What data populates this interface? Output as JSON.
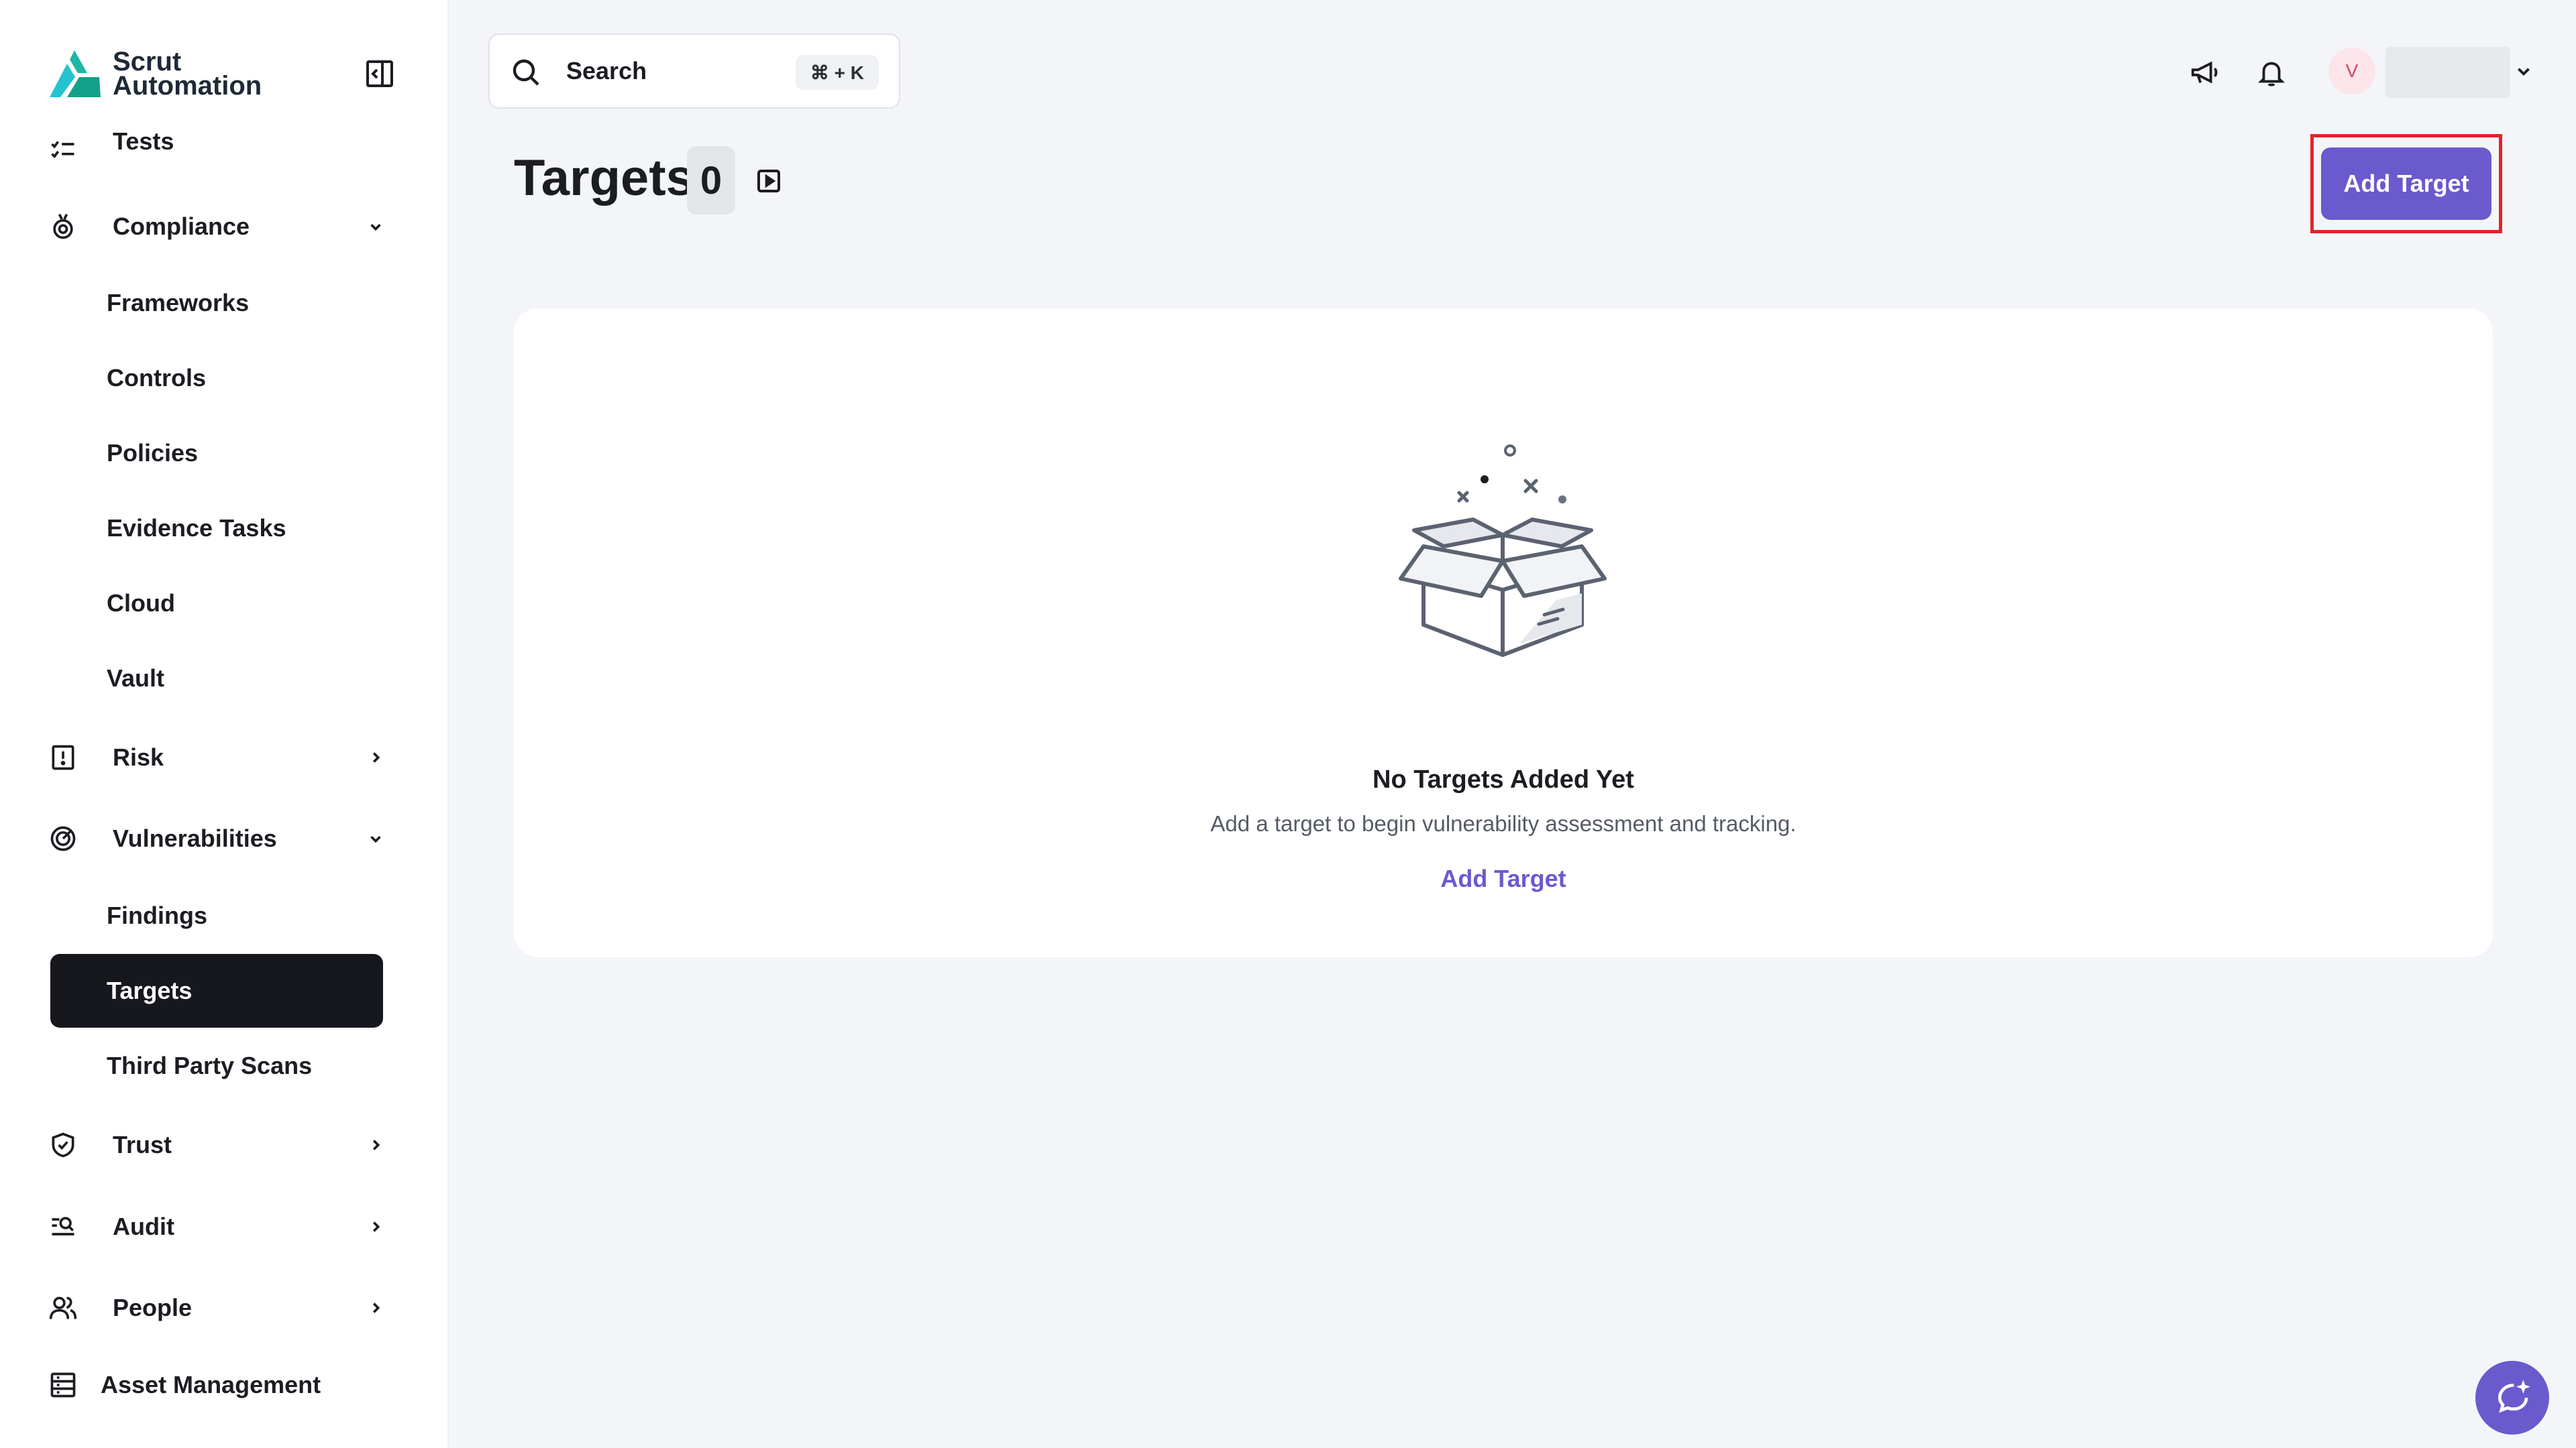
{
  "brand": {
    "line1": "Scrut",
    "line2": "Automation"
  },
  "sidebar": {
    "partial_item": "Tests",
    "compliance": {
      "label": "Compliance",
      "children": [
        "Frameworks",
        "Controls",
        "Policies",
        "Evidence Tasks",
        "Cloud",
        "Vault"
      ]
    },
    "risk": {
      "label": "Risk"
    },
    "vulnerabilities": {
      "label": "Vulnerabilities",
      "children": [
        "Findings",
        "Targets",
        "Third Party Scans"
      ],
      "active_child": "Targets"
    },
    "trust": {
      "label": "Trust"
    },
    "audit": {
      "label": "Audit"
    },
    "people": {
      "label": "People"
    },
    "asset_management": {
      "label": "Asset Management"
    }
  },
  "search": {
    "label": "Search",
    "shortcut": "⌘ + K"
  },
  "user": {
    "initial": "V"
  },
  "page": {
    "title": "Targets",
    "count": "0",
    "add_button": "Add Target"
  },
  "empty_state": {
    "title": "No Targets Added Yet",
    "description": "Add a target to begin vulnerability assessment and tracking.",
    "link": "Add Target"
  },
  "colors": {
    "accent": "#6a5acd",
    "active_nav_bg": "#16181d",
    "highlight_border": "#e0242a",
    "brand_teal": "#1fb5a8"
  },
  "icons": {
    "logo": "scrut-logo-icon",
    "collapse": "sidebar-collapse-icon",
    "search": "search-icon",
    "announcement": "megaphone-icon",
    "notification": "bell-icon",
    "chat": "chat-sparkle-icon"
  }
}
